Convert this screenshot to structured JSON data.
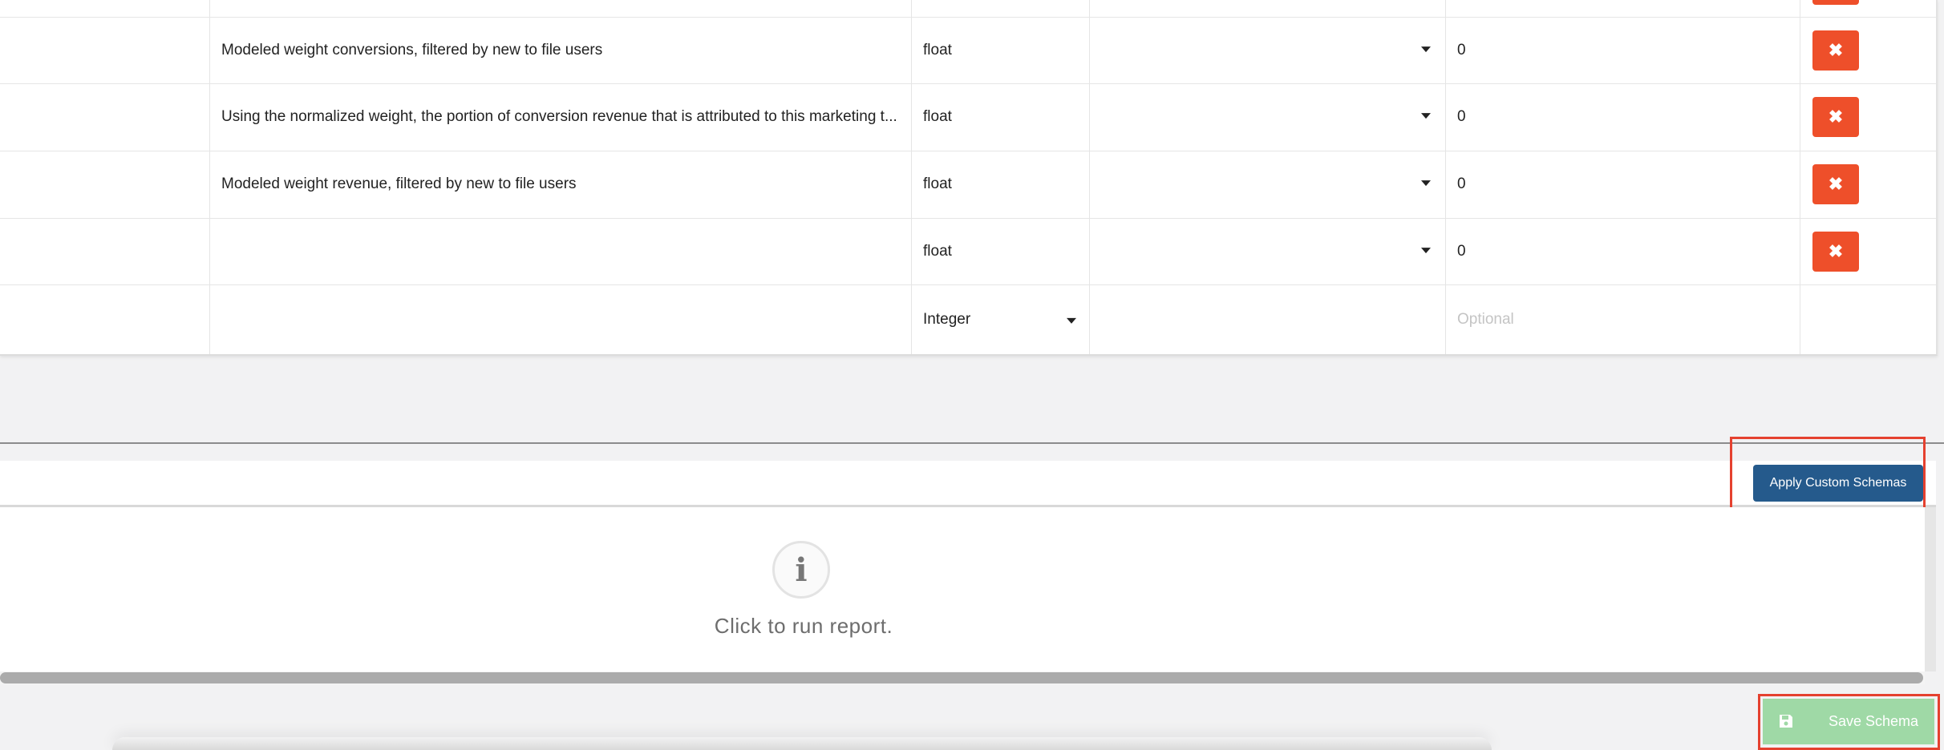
{
  "rows": [
    {
      "description": "",
      "type": "",
      "default": "",
      "delete_label": "✖"
    },
    {
      "description": "Modeled weight conversions, filtered by new to file users",
      "type": "float",
      "default": "0",
      "delete_label": "✖"
    },
    {
      "description": "Using the normalized weight, the portion of conversion revenue that is attributed to this marketing t...",
      "type": "float",
      "default": "0",
      "delete_label": "✖"
    },
    {
      "description": "Modeled weight revenue, filtered by new to file users",
      "type": "float",
      "default": "0",
      "delete_label": "✖"
    },
    {
      "description": "",
      "type": "float",
      "default": "0",
      "delete_label": "✖"
    }
  ],
  "new_row": {
    "type_value": "Integer",
    "default_placeholder": "Optional"
  },
  "apply_button_label": "Apply Custom Schemas",
  "report": {
    "info_icon": "i",
    "run_text": "Click to run report."
  },
  "save_button_label": "Save Schema",
  "colors": {
    "delete": "#ee4f2a",
    "apply": "#255a8c",
    "save": "#9fd9a6",
    "highlight": "#e5412f"
  }
}
